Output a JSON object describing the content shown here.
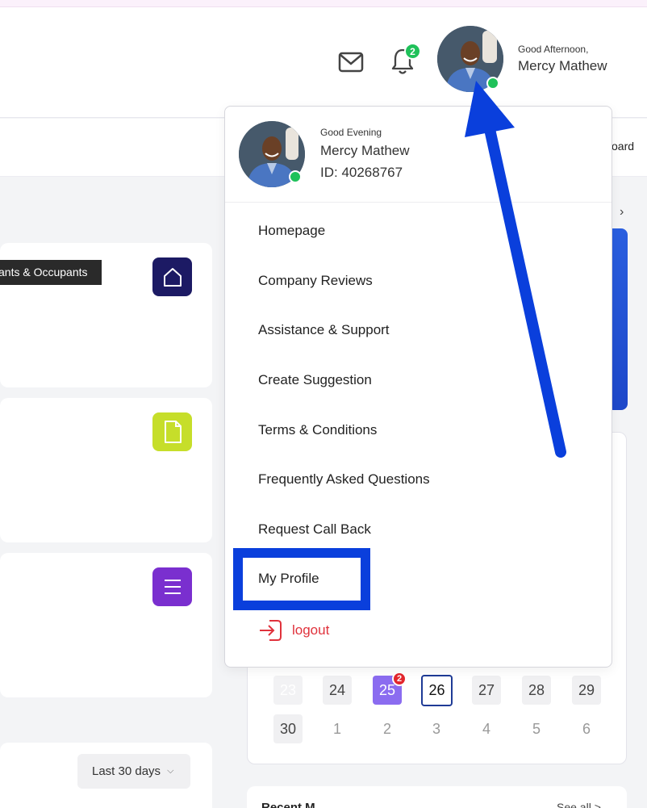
{
  "header": {
    "greeting": "Good Afternoon,",
    "user_name": "Mercy Mathew",
    "notification_count": "2",
    "subbar_text": "oard"
  },
  "tooltip": "ants & Occupants",
  "tiles": [
    {
      "icon": "home-icon",
      "color": "#1c1a64"
    },
    {
      "icon": "document-icon",
      "color": "#c6de2a"
    },
    {
      "icon": "list-icon",
      "color": "#7a2fcf"
    }
  ],
  "dropdown": {
    "greeting": "Good Evening",
    "user_name": "Mercy Mathew",
    "user_id": "ID: 40268767",
    "items": [
      {
        "label": "Homepage"
      },
      {
        "label": "Company Reviews"
      },
      {
        "label": "Assistance & Support"
      },
      {
        "label": "Create Suggestion"
      },
      {
        "label": "Terms & Conditions"
      },
      {
        "label": "Frequently Asked Questions"
      },
      {
        "label": "Request Call Back"
      },
      {
        "label": "My Profile"
      }
    ],
    "logout_label": "logout"
  },
  "calendar": {
    "row1": [
      "23",
      "24",
      "25",
      "26",
      "27",
      "28",
      "29"
    ],
    "row2": [
      "30",
      "1",
      "2",
      "3",
      "4",
      "5",
      "6"
    ],
    "selected_badge": "2"
  },
  "range_select": {
    "value": "Last 30 days"
  },
  "bottom": {
    "left": "Recent M",
    "right": "See all >"
  },
  "colors": {
    "accent_blue": "#0a3fdc",
    "online_green": "#1fc15a",
    "logout_red": "#e0323c",
    "selected_purple": "#8b6cf0"
  }
}
